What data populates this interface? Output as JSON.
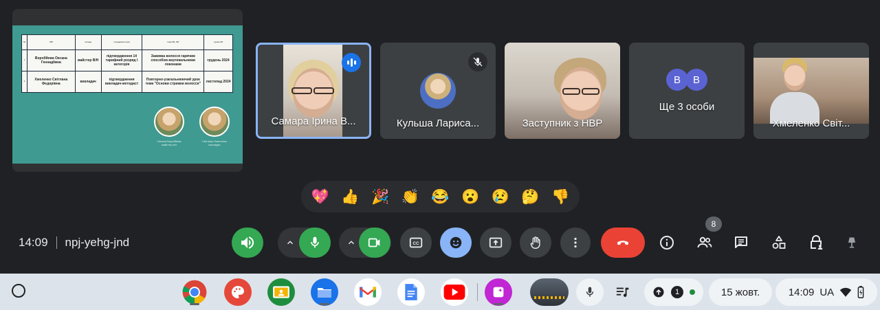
{
  "presentation": {
    "table": {
      "headers": [
        "№",
        "ПІБ",
        "посада",
        "посада/категорія",
        "тема ВК, МР",
        "термін ВУ"
      ],
      "rows": [
        [
          "1",
          "Воробйова Оксана Геннадіївна",
          "майстер В/Н",
          "підтвердження 14 тарифний розряд І категорія",
          "Завивка волосся гарячим способом вертикальними локонами",
          "грудень 2024"
        ],
        [
          "2",
          "Хмеленко Світлана Федорівна",
          "викладач",
          "підтвердження викладач-методист",
          "Повторно-узагальнюючий урок тема \"Основи стрижки волосся\"",
          "листопад 2024"
        ]
      ]
    },
    "faces": [
      {
        "name": "Оксана Воробйова",
        "role": "майстер в/н"
      },
      {
        "name": "Світлана Хмеленко",
        "role": "викладач"
      }
    ]
  },
  "participants": [
    {
      "name": "Самара Ірина В...",
      "state": "speaking"
    },
    {
      "name": "Кульша Лариса...",
      "state": "muted"
    },
    {
      "name": "Заступник з НВР",
      "state": "video"
    },
    {
      "name": "Ще 3 особи",
      "avatars": [
        "В",
        "В"
      ]
    },
    {
      "name": "Хмеленко Світ...",
      "state": "video"
    }
  ],
  "reactions": [
    "💖",
    "👍",
    "🎉",
    "👏",
    "😂",
    "😮",
    "😢",
    "🤔",
    "👎"
  ],
  "meeting": {
    "time": "14:09",
    "code": "npj-yehg-jnd"
  },
  "controls": {
    "participants_count": "8",
    "colors": {
      "green": "#34a853",
      "red": "#ea4335",
      "blue": "#8ab4f8",
      "gray": "#3c4043"
    }
  },
  "taskbar": {
    "apps": [
      "chrome-icon",
      "canvas-icon",
      "classroom-icon",
      "files-icon",
      "gmail-icon",
      "docs-icon",
      "youtube-icon",
      "jamboard-icon"
    ],
    "notification_count": "1",
    "date": "15 жовт.",
    "time": "14:09",
    "keyboard_layout": "UA"
  }
}
